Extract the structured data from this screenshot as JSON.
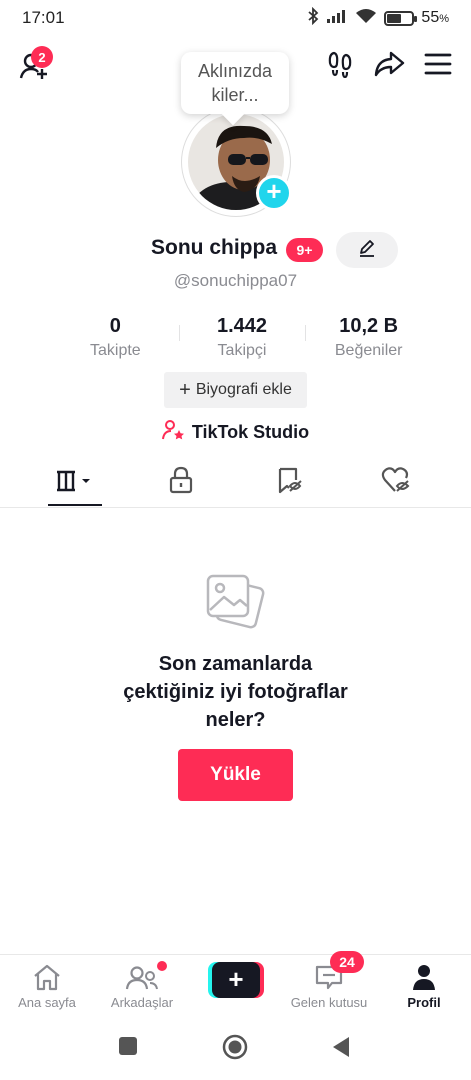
{
  "status_bar": {
    "time": "17:01",
    "battery_percent": "55",
    "battery_unit": "%",
    "battery_level": 0.55
  },
  "top_nav": {
    "add_friend_badge": "2",
    "icons": [
      "add-friend-icon",
      "footprint-icon",
      "share-icon",
      "menu-icon"
    ]
  },
  "tooltip": {
    "text": "Aklınızda kiler..."
  },
  "profile": {
    "name": "Sonu chippa",
    "badge": "9+",
    "handle": "@sonuchippa07"
  },
  "stats": [
    {
      "value": "0",
      "label": "Takipte"
    },
    {
      "value": "1.442",
      "label": "Takipçi"
    },
    {
      "value": "10,2 B",
      "label": "Beğeniler"
    }
  ],
  "bio_button": {
    "icon": "+",
    "label": "Biyografi ekle"
  },
  "studio_link": {
    "label": "TikTok Studio"
  },
  "tabs": [
    "videos-grid-tab",
    "private-tab",
    "reposts-tab",
    "liked-tab"
  ],
  "empty_state": {
    "line1": "Son zamanlarda",
    "line2": "çektiğiniz iyi fotoğraflar",
    "line3": "neler?",
    "button": "Yükle"
  },
  "bottom_nav": {
    "home": "Ana sayfa",
    "friends": "Arkadaşlar",
    "create": "+",
    "inbox": "Gelen kutusu",
    "inbox_badge": "24",
    "profile": "Profil"
  },
  "colors": {
    "accent": "#fe2c55",
    "cyan": "#20d5ec",
    "text": "#161823",
    "muted": "#8a8b91"
  }
}
